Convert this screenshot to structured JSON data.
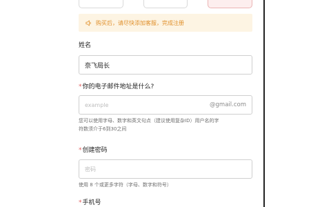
{
  "notice": {
    "icon": "speaker-icon",
    "text": "购买后，请尽快添加客服，完成注册"
  },
  "name_field": {
    "label": "姓名",
    "value": "奈飞局长"
  },
  "email_field": {
    "required_mark": "*",
    "label": "你的电子邮件地址是什么?",
    "placeholder": "example",
    "suffix": "@gmail.com",
    "help_line1": "您可以使用字母、数字和英文句点（建议使用复杂ID）用户名的字",
    "help_line2": "符数须介于6到30之间"
  },
  "password_field": {
    "required_mark": "*",
    "label": "创建密码",
    "placeholder": "密码",
    "help": "使用 8 个或更多字符（字母、数字和符号）"
  },
  "phone_field": {
    "required_mark": "*",
    "label": "手机号"
  },
  "colors": {
    "accent": "#e05a5a",
    "notice_bg": "#fdf4e3",
    "notice_text": "#e0902c"
  }
}
